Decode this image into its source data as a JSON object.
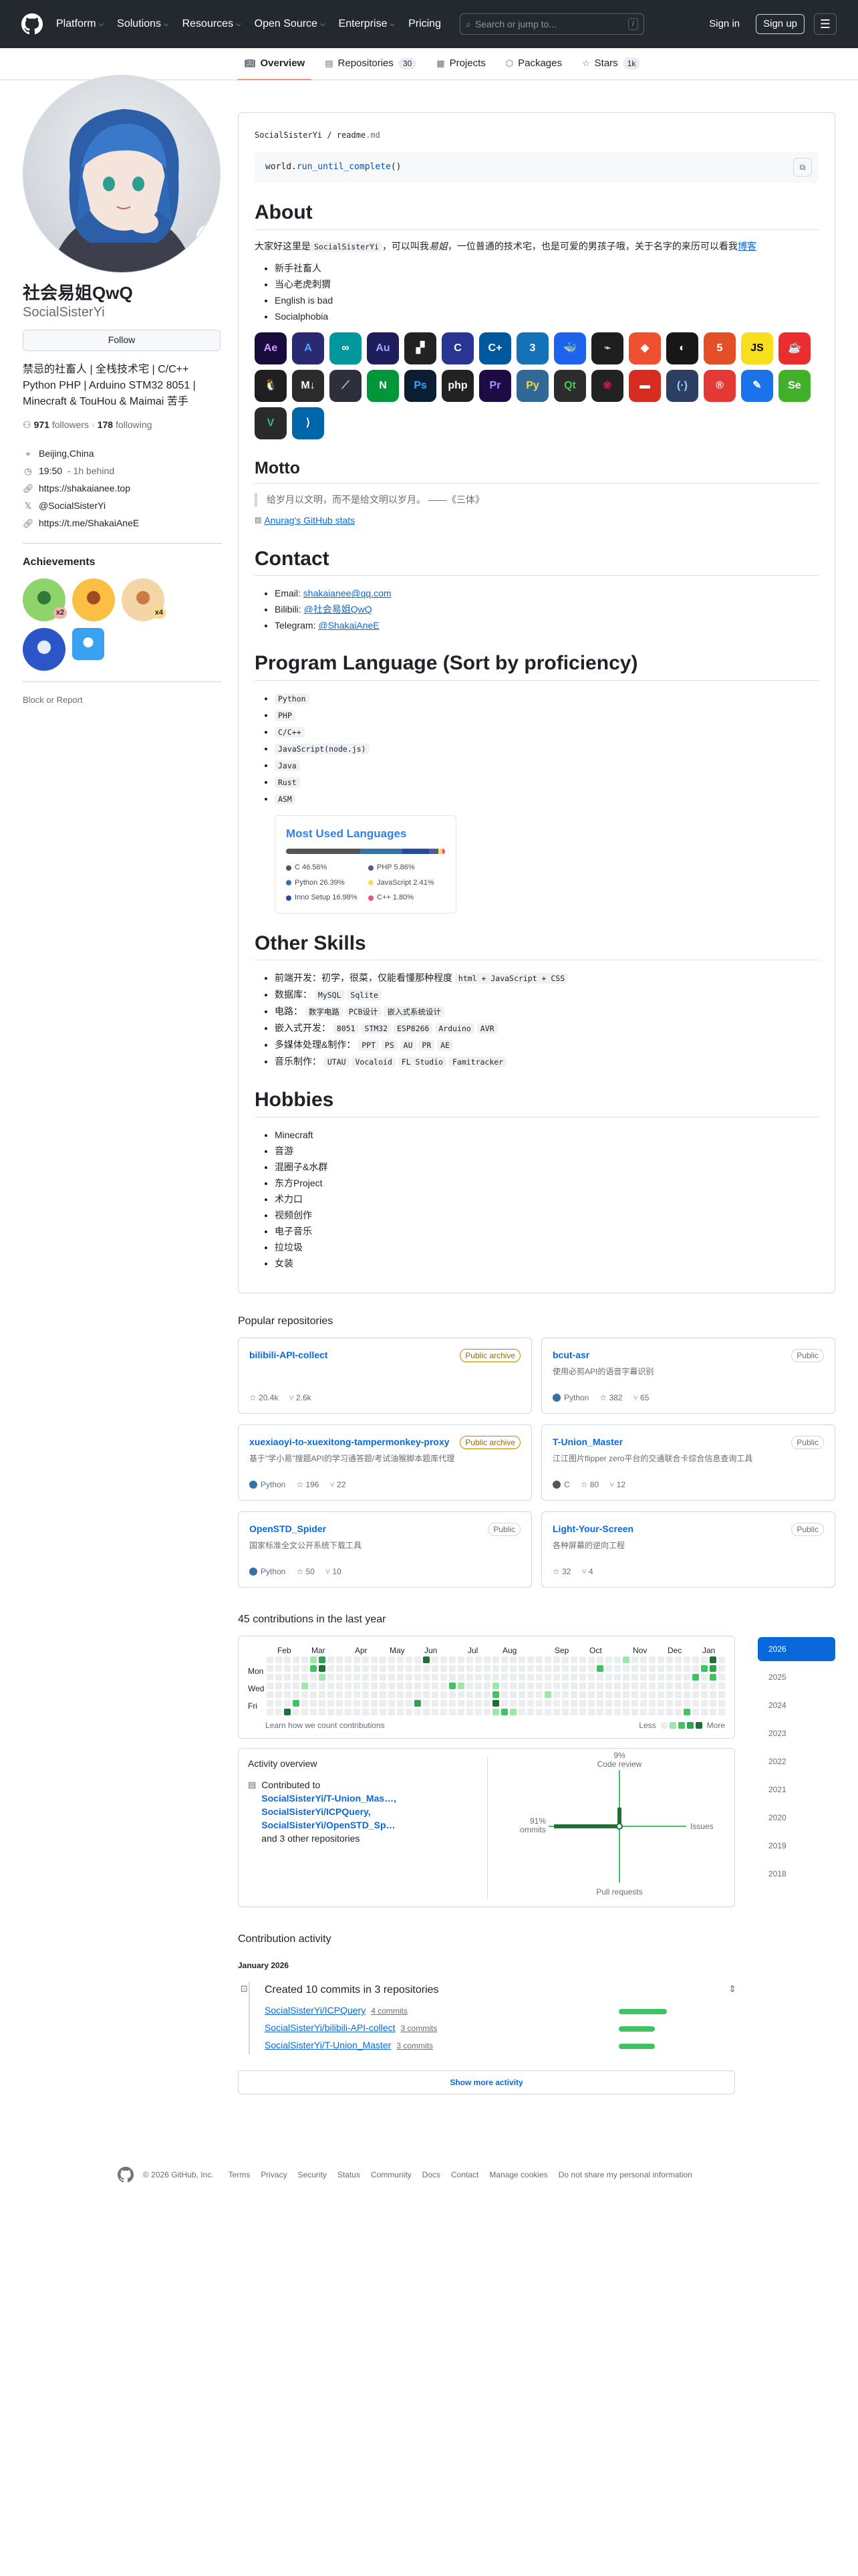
{
  "header": {
    "nav": [
      "Platform",
      "Solutions",
      "Resources",
      "Open Source",
      "Enterprise",
      "Pricing"
    ],
    "search_placeholder": "Search or jump to...",
    "search_shortcut": "/",
    "sign_in": "Sign in",
    "sign_up": "Sign up"
  },
  "tabs": [
    {
      "label": "Overview",
      "icon": "book-icon",
      "active": true
    },
    {
      "label": "Repositories",
      "icon": "repo-icon",
      "count": "30"
    },
    {
      "label": "Projects",
      "icon": "table-icon"
    },
    {
      "label": "Packages",
      "icon": "package-icon"
    },
    {
      "label": "Stars",
      "icon": "star-icon",
      "count": "1k"
    }
  ],
  "profile": {
    "name": "社会易姐QwQ",
    "login": "SocialSisterYi",
    "follow": "Follow",
    "bio": "禁忌的社畜人 | 全栈技术宅 | C/C++ Python PHP | Arduino STM32 8051 | Minecraft & TouHou & Maimai 苦手",
    "followers": "971",
    "followers_label": "followers",
    "following": "178",
    "following_label": "following",
    "location": "Beijing,China",
    "localtime": "19:50",
    "time_behind": "- 1h behind",
    "website": "https://shakaianee.top",
    "twitter": "@SocialSisterYi",
    "telegram": "https://t.me/ShakaiAneE",
    "achievements_title": "Achievements",
    "achievement_tiers": [
      "x2",
      "",
      "x4",
      "",
      ""
    ],
    "block": "Block or Report"
  },
  "readme": {
    "path_user": "SocialSisterYi",
    "path_file": "readme",
    "path_ext": ".md",
    "code_obj": "world.",
    "code_fn": "run_until_complete",
    "code_tail": "()",
    "about_title": "About",
    "about_intro_a": "大家好这里是",
    "about_intro_code": "SocialSisterYi",
    "about_intro_b": "，可以叫我",
    "about_intro_em": "易姐",
    "about_intro_c": "，一位普通的技术宅，也是可爱的男孩子哦，关于名字的来历可以看我",
    "about_intro_link": "博客",
    "about_list": [
      "新手社畜人",
      "当心老虎刺猬",
      "English is bad",
      "Socialphobia"
    ],
    "skill_icons": [
      {
        "t": "Ae",
        "bg": "#1a0b3d",
        "fg": "#d19cff"
      },
      {
        "t": "A",
        "bg": "#2a2a72",
        "fg": "#48a9ff"
      },
      {
        "t": "∞",
        "bg": "#00979d",
        "fg": "#fff"
      },
      {
        "t": "Au",
        "bg": "#1e1e5c",
        "fg": "#9aa6ff"
      },
      {
        "t": "▞",
        "bg": "#222",
        "fg": "#fff"
      },
      {
        "t": "C",
        "bg": "#283593",
        "fg": "#fff"
      },
      {
        "t": "C+",
        "bg": "#00599c",
        "fg": "#fff"
      },
      {
        "t": "3",
        "bg": "#1572b6",
        "fg": "#fff"
      },
      {
        "t": "🐳",
        "bg": "#1d63ed",
        "fg": "#fff"
      },
      {
        "t": "⌁",
        "bg": "#1e1e1e",
        "fg": "#ccc"
      },
      {
        "t": "◆",
        "bg": "#f05032",
        "fg": "#fff"
      },
      {
        "t": "◐",
        "bg": "#181717",
        "fg": "#fff"
      },
      {
        "t": "5",
        "bg": "#e34f26",
        "fg": "#fff"
      },
      {
        "t": "JS",
        "bg": "#f7df1e",
        "fg": "#000"
      },
      {
        "t": "☕",
        "bg": "#ea2d2e",
        "fg": "#fff"
      },
      {
        "t": "🐧",
        "bg": "#1f1f1f",
        "fg": "#fff"
      },
      {
        "t": "M↓",
        "bg": "#2b2b2b",
        "fg": "#fff"
      },
      {
        "t": "⟋",
        "bg": "#2d2f3a",
        "fg": "#ccc"
      },
      {
        "t": "N",
        "bg": "#009639",
        "fg": "#fff"
      },
      {
        "t": "Ps",
        "bg": "#0a1d33",
        "fg": "#31a8ff"
      },
      {
        "t": "php",
        "bg": "#222",
        "fg": "#fff"
      },
      {
        "t": "Pr",
        "bg": "#1f0b44",
        "fg": "#9999ff"
      },
      {
        "t": "Py",
        "bg": "#306998",
        "fg": "#ffd43b"
      },
      {
        "t": "Qt",
        "bg": "#2c2c2c",
        "fg": "#41cd52"
      },
      {
        "t": "❀",
        "bg": "#222",
        "fg": "#c51a4a"
      },
      {
        "t": "▬",
        "bg": "#d82c20",
        "fg": "#fff"
      },
      {
        "t": "(·)",
        "bg": "#2d3e63",
        "fg": "#9cf"
      },
      {
        "t": "®",
        "bg": "#e53935",
        "fg": "#fff"
      },
      {
        "t": "✎",
        "bg": "#1a73e8",
        "fg": "#fff"
      },
      {
        "t": "Se",
        "bg": "#43b02a",
        "fg": "#fff"
      },
      {
        "t": "V",
        "bg": "#2a2a2a",
        "fg": "#42b883"
      },
      {
        "t": "⟩",
        "bg": "#0065a9",
        "fg": "#fff"
      }
    ],
    "motto_title": "Motto",
    "motto": "给岁月以文明，而不是给文明以岁月。 ——《三体》",
    "stats_alt": "Anurag's GitHub stats",
    "contact_title": "Contact",
    "contacts": [
      {
        "k": "Email: ",
        "v": "shakaianee@qq.com"
      },
      {
        "k": "Bilibili: ",
        "v": "@社会易姐QwQ"
      },
      {
        "k": "Telegram: ",
        "v": "@ShakaiAneE"
      }
    ],
    "lang_title": "Program Language (Sort by proficiency)",
    "langs": [
      "Python",
      "PHP",
      "C/C++",
      "JavaScript(node.js)",
      "Java",
      "Rust",
      "ASM"
    ],
    "card_title": "Most Used Languages",
    "card_langs": [
      {
        "name": "C 46.56%",
        "pct": 46.56,
        "color": "#555555"
      },
      {
        "name": "PHP 5.86%",
        "pct": 5.86,
        "color": "#4F5D95"
      },
      {
        "name": "Python 26.39%",
        "pct": 26.39,
        "color": "#3572A5"
      },
      {
        "name": "JavaScript 2.41%",
        "pct": 2.41,
        "color": "#f1e05a"
      },
      {
        "name": "Inno Setup 16.98%",
        "pct": 16.98,
        "color": "#264b99"
      },
      {
        "name": "C++ 1.80%",
        "pct": 1.8,
        "color": "#f34b7d"
      }
    ],
    "other_title": "Other Skills",
    "other_skills": [
      {
        "label": "前端开发：初学，很菜，仅能看懂那种程度",
        "codes": [
          "html + JavaScript + CSS"
        ]
      },
      {
        "label": "数据库：",
        "codes": [
          "MySQL",
          "Sqlite"
        ]
      },
      {
        "label": "电路：",
        "codes": [
          "数字电路",
          "PCB设计",
          "嵌入式系统设计"
        ]
      },
      {
        "label": "嵌入式开发：",
        "codes": [
          "8051",
          "STM32",
          "ESP8266",
          "Arduino",
          "AVR"
        ]
      },
      {
        "label": "多媒体处理&制作：",
        "codes": [
          "PPT",
          "PS",
          "AU",
          "PR",
          "AE"
        ]
      },
      {
        "label": "音乐制作：",
        "codes": [
          "UTAU",
          "Vocaloid",
          "FL Studio",
          "Famitracker"
        ]
      }
    ],
    "hobbies_title": "Hobbies",
    "hobbies": [
      "Minecraft",
      "音游",
      "混圈子&水群",
      "东方Project",
      "术力口",
      "视频创作",
      "电子音乐",
      "拉垃圾",
      "女装"
    ]
  },
  "popular": {
    "title": "Popular repositories",
    "repos": [
      {
        "name": "bilibili-API-collect",
        "label": "Public archive",
        "archived": true,
        "desc": "",
        "lang": "",
        "langColor": "",
        "stars": "20.4k",
        "forks": "2.6k"
      },
      {
        "name": "bcut-asr",
        "label": "Public",
        "archived": false,
        "desc": "使用必剪API的语音字幕识别",
        "lang": "Python",
        "langColor": "#3572A5",
        "stars": "382",
        "forks": "65"
      },
      {
        "name": "xuexiaoyi-to-xuexitong-tampermonkey-proxy",
        "label": "Public archive",
        "archived": true,
        "desc": "基于\"学小易\"搜题API的学习通答题/考试油猴脚本题库代理",
        "lang": "Python",
        "langColor": "#3572A5",
        "stars": "196",
        "forks": "22"
      },
      {
        "name": "T-Union_Master",
        "label": "Public",
        "archived": false,
        "desc": "江江图片flipper zero平台的交通联合卡综合信息查询工具",
        "lang": "C",
        "langColor": "#555555",
        "stars": "80",
        "forks": "12"
      },
      {
        "name": "OpenSTD_Spider",
        "label": "Public",
        "archived": false,
        "desc": "国家标准全文公开系统下载工具",
        "lang": "Python",
        "langColor": "#3572A5",
        "stars": "50",
        "forks": "10"
      },
      {
        "name": "Light-Your-Screen",
        "label": "Public",
        "archived": false,
        "desc": "各种屏幕的逆向工程",
        "lang": "",
        "langColor": "",
        "stars": "32",
        "forks": "4"
      }
    ]
  },
  "contributions": {
    "title": "45 contributions in the last year",
    "months": [
      "Feb",
      "Mar",
      "Apr",
      "May",
      "Jun",
      "Jul",
      "Aug",
      "Sep",
      "Oct",
      "Nov",
      "Dec",
      "Jan"
    ],
    "days": [
      "Mon",
      "Wed",
      "Fri"
    ],
    "learn": "Learn how we count contributions",
    "less": "Less",
    "more": "More",
    "levels": [
      [
        0,
        0,
        0,
        0,
        0,
        0,
        0
      ],
      [
        0,
        0,
        0,
        0,
        0,
        0,
        0
      ],
      [
        0,
        0,
        0,
        0,
        0,
        0,
        4
      ],
      [
        0,
        0,
        0,
        0,
        0,
        2,
        0
      ],
      [
        0,
        0,
        0,
        1,
        0,
        0,
        0
      ],
      [
        1,
        2,
        0,
        0,
        0,
        0,
        0
      ],
      [
        3,
        4,
        1,
        0,
        0,
        0,
        0
      ],
      [
        0,
        0,
        0,
        0,
        0,
        0,
        0
      ],
      [
        0,
        0,
        0,
        0,
        0,
        0,
        0
      ],
      [
        0,
        0,
        0,
        0,
        0,
        0,
        0
      ],
      [
        0,
        0,
        0,
        0,
        0,
        0,
        0
      ],
      [
        0,
        0,
        0,
        0,
        0,
        0,
        0
      ],
      [
        0,
        0,
        0,
        0,
        0,
        0,
        0
      ],
      [
        0,
        0,
        0,
        0,
        0,
        0,
        0
      ],
      [
        0,
        0,
        0,
        0,
        0,
        0,
        0
      ],
      [
        0,
        0,
        0,
        0,
        0,
        0,
        0
      ],
      [
        0,
        0,
        0,
        0,
        0,
        0,
        0
      ],
      [
        0,
        0,
        0,
        0,
        0,
        3,
        0
      ],
      [
        4,
        0,
        0,
        0,
        0,
        0,
        0
      ],
      [
        0,
        0,
        0,
        0,
        0,
        0,
        0
      ],
      [
        0,
        0,
        0,
        0,
        0,
        0,
        0
      ],
      [
        0,
        0,
        0,
        2,
        0,
        0,
        0
      ],
      [
        0,
        0,
        0,
        1,
        0,
        0,
        0
      ],
      [
        0,
        0,
        0,
        0,
        0,
        0,
        0
      ],
      [
        0,
        0,
        0,
        0,
        0,
        0,
        0
      ],
      [
        0,
        0,
        0,
        0,
        0,
        0,
        0
      ],
      [
        0,
        0,
        0,
        1,
        2,
        4,
        1
      ],
      [
        0,
        0,
        0,
        0,
        0,
        0,
        2
      ],
      [
        0,
        0,
        0,
        0,
        0,
        0,
        1
      ],
      [
        0,
        0,
        0,
        0,
        0,
        0,
        0
      ],
      [
        0,
        0,
        0,
        0,
        0,
        0,
        0
      ],
      [
        0,
        0,
        0,
        0,
        0,
        0,
        0
      ],
      [
        0,
        0,
        0,
        0,
        1,
        0,
        0
      ],
      [
        0,
        0,
        0,
        0,
        0,
        0,
        0
      ],
      [
        0,
        0,
        0,
        0,
        0,
        0,
        0
      ],
      [
        0,
        0,
        0,
        0,
        0,
        0,
        0
      ],
      [
        0,
        0,
        0,
        0,
        0,
        0,
        0
      ],
      [
        0,
        0,
        0,
        0,
        0,
        0,
        0
      ],
      [
        0,
        2,
        0,
        0,
        0,
        0,
        0
      ],
      [
        0,
        0,
        0,
        0,
        0,
        0,
        0
      ],
      [
        0,
        0,
        0,
        0,
        0,
        0,
        0
      ],
      [
        1,
        0,
        0,
        0,
        0,
        0,
        0
      ],
      [
        0,
        0,
        0,
        0,
        0,
        0,
        0
      ],
      [
        0,
        0,
        0,
        0,
        0,
        0,
        0
      ],
      [
        0,
        0,
        0,
        0,
        0,
        0,
        0
      ],
      [
        0,
        0,
        0,
        0,
        0,
        0,
        0
      ],
      [
        0,
        0,
        0,
        0,
        0,
        0,
        0
      ],
      [
        0,
        0,
        0,
        0,
        0,
        0,
        0
      ],
      [
        0,
        0,
        0,
        0,
        0,
        0,
        2
      ],
      [
        0,
        0,
        2,
        0,
        0,
        0,
        0
      ],
      [
        0,
        2,
        0,
        0,
        0,
        0,
        0
      ],
      [
        4,
        3,
        2,
        0,
        0,
        0,
        0
      ],
      [
        0,
        0,
        0,
        0,
        0,
        0,
        0
      ]
    ],
    "years": [
      "2026",
      "2025",
      "2024",
      "2023",
      "2022",
      "2021",
      "2020",
      "2019",
      "2018"
    ],
    "overview_title": "Activity overview",
    "contributed_to": "Contributed to",
    "contributed_repos": [
      "SocialSisterYi/T-Union_Mas…,",
      "SocialSisterYi/ICPQuery,",
      "SocialSisterYi/OpenSTD_Sp…"
    ],
    "and_more": "and 3 other repositories",
    "axis": {
      "top": "Code review",
      "top_pct": "9%",
      "left": "Commits",
      "left_pct": "91%",
      "right": "Issues",
      "bottom": "Pull requests"
    },
    "activity_title": "Contribution activity",
    "month": "January 2026",
    "commits_title": "Created 10 commits in 3 repositories",
    "commit_repos": [
      {
        "name": "SocialSisterYi/ICPQuery",
        "count": "4 commits",
        "bar": 0.4
      },
      {
        "name": "SocialSisterYi/bilibili-API-collect",
        "count": "3 commits",
        "bar": 0.3
      },
      {
        "name": "SocialSisterYi/T-Union_Master",
        "count": "3 commits",
        "bar": 0.3
      }
    ],
    "show_more": "Show more activity"
  },
  "footer": {
    "copyright": "© 2026 GitHub, Inc.",
    "links": [
      "Terms",
      "Privacy",
      "Security",
      "Status",
      "Community",
      "Docs",
      "Contact",
      "Manage cookies",
      "Do not share my personal information"
    ]
  }
}
